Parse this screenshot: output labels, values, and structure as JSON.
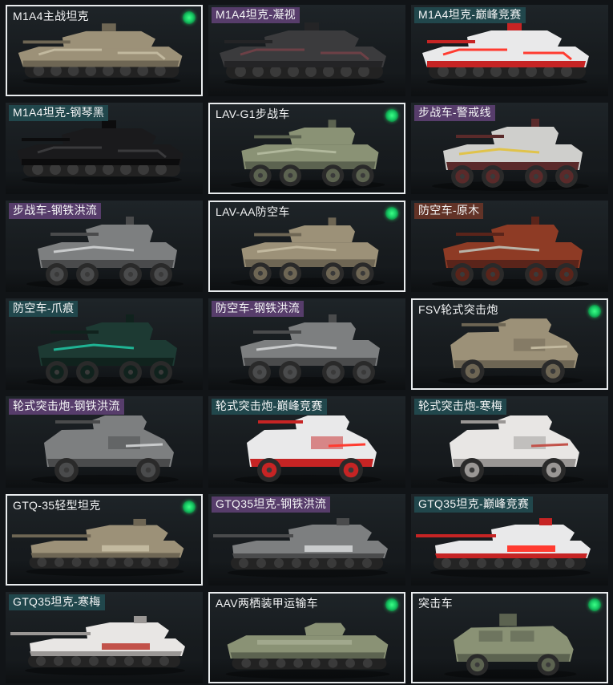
{
  "vehicles": [
    {
      "name": "M1A4主战坦克",
      "type": "tank",
      "skin": "desert",
      "owned": true,
      "tier": "none"
    },
    {
      "name": "M1A4坦克-凝视",
      "type": "tank",
      "skin": "gaze",
      "owned": false,
      "tier": "purple"
    },
    {
      "name": "M1A4坦克-巅峰竞赛",
      "type": "tank",
      "skin": "race",
      "owned": false,
      "tier": "teal"
    },
    {
      "name": "M1A4坦克-钢琴黑",
      "type": "tank",
      "skin": "black",
      "owned": false,
      "tier": "teal"
    },
    {
      "name": "LAV-G1步战车",
      "type": "ifv",
      "skin": "olive",
      "owned": true,
      "tier": "none"
    },
    {
      "name": "步战车-警戒线",
      "type": "ifv",
      "skin": "caution",
      "owned": false,
      "tier": "purple"
    },
    {
      "name": "步战车-钢铁洪流",
      "type": "ifv",
      "skin": "steel",
      "owned": false,
      "tier": "purple"
    },
    {
      "name": "LAV-AA防空车",
      "type": "ifv",
      "skin": "desert",
      "owned": true,
      "tier": "none"
    },
    {
      "name": "防空车-原木",
      "type": "ifv",
      "skin": "wood",
      "owned": false,
      "tier": "brown"
    },
    {
      "name": "防空车-爪痕",
      "type": "ifv",
      "skin": "claw",
      "owned": false,
      "tier": "teal"
    },
    {
      "name": "防空车-钢铁洪流",
      "type": "ifv",
      "skin": "steel",
      "owned": false,
      "tier": "purple"
    },
    {
      "name": "FSV轮式突击炮",
      "type": "fsv",
      "skin": "desert",
      "owned": true,
      "tier": "none"
    },
    {
      "name": "轮式突击炮-钢铁洪流",
      "type": "fsv",
      "skin": "steel",
      "owned": false,
      "tier": "purple"
    },
    {
      "name": "轮式突击炮-巅峰竞赛",
      "type": "fsv",
      "skin": "race",
      "owned": false,
      "tier": "teal"
    },
    {
      "name": "轮式突击炮-寒梅",
      "type": "fsv",
      "skin": "plum",
      "owned": false,
      "tier": "teal"
    },
    {
      "name": "GTQ-35轻型坦克",
      "type": "light",
      "skin": "desert",
      "owned": true,
      "tier": "none"
    },
    {
      "name": "GTQ35坦克-钢铁洪流",
      "type": "light",
      "skin": "steel",
      "owned": false,
      "tier": "purple"
    },
    {
      "name": "GTQ35坦克-巅峰竞赛",
      "type": "light",
      "skin": "race",
      "owned": false,
      "tier": "teal"
    },
    {
      "name": "GTQ35坦克-寒梅",
      "type": "light",
      "skin": "plum",
      "owned": false,
      "tier": "teal"
    },
    {
      "name": "AAV两栖装甲运输车",
      "type": "aav",
      "skin": "olive",
      "owned": true,
      "tier": "none"
    },
    {
      "name": "突击车",
      "type": "assault",
      "skin": "olive",
      "owned": true,
      "tier": "none"
    }
  ],
  "palette": {
    "desert": {
      "body": "#9c9178",
      "dark": "#6e6654",
      "light": "#c2b99f"
    },
    "gaze": {
      "body": "#3b3b3d",
      "dark": "#242426",
      "light": "#6d4046"
    },
    "race": {
      "body": "#e9e9ea",
      "dark": "#c62424",
      "light": "#ff3b30"
    },
    "black": {
      "body": "#1a1a1c",
      "dark": "#0c0c0d",
      "light": "#3a3a3c"
    },
    "olive": {
      "body": "#8a9275",
      "dark": "#5c6350",
      "light": "#b1b89c"
    },
    "caution": {
      "body": "#cfcfcc",
      "dark": "#5a2a2a",
      "light": "#e0c34a"
    },
    "steel": {
      "body": "#7d7f80",
      "dark": "#4a4b4c",
      "light": "#c9cbcc"
    },
    "wood": {
      "body": "#8e3b25",
      "dark": "#5a241a",
      "light": "#b8b3a8"
    },
    "claw": {
      "body": "#1d3a33",
      "dark": "#10221d",
      "light": "#1fb394"
    },
    "plum": {
      "body": "#e8e6e4",
      "dark": "#9a9795",
      "light": "#c2524a"
    }
  },
  "icons": {
    "owned_indicator": "green-dot-icon"
  }
}
